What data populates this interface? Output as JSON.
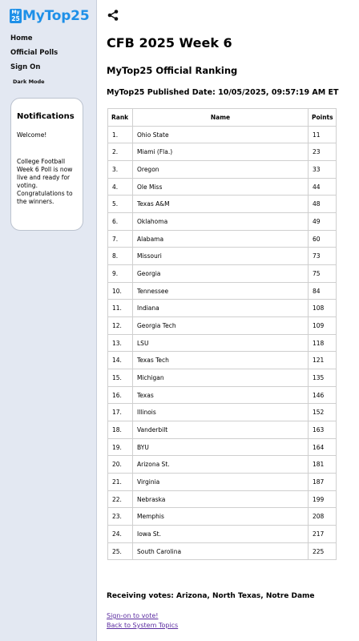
{
  "sidebar": {
    "logo_badge_top": "My",
    "logo_badge_bottom": "25",
    "logo_text": "MyTop25",
    "nav": [
      "Home",
      "Official Polls",
      "Sign On"
    ],
    "dark_mode": "Dark Mode",
    "notifications": {
      "title": "Notifications",
      "welcome": "Welcome!",
      "message": "College Football Week 6 Poll is now live and ready for voting. Congratulations to the winners."
    }
  },
  "main": {
    "share_icon": "share-icon",
    "title": "CFB 2025 Week 6",
    "subtitle": "MyTop25 Official Ranking",
    "published": "MyTop25 Published Date: 10/05/2025, 09:57:19 AM ET",
    "table": {
      "headers": [
        "Rank",
        "Name",
        "Points"
      ],
      "rows": [
        [
          "1.",
          "Ohio State",
          "11"
        ],
        [
          "2.",
          "Miami (Fla.)",
          "23"
        ],
        [
          "3.",
          "Oregon",
          "33"
        ],
        [
          "4.",
          "Ole Miss",
          "44"
        ],
        [
          "5.",
          "Texas A&M",
          "48"
        ],
        [
          "6.",
          "Oklahoma",
          "49"
        ],
        [
          "7.",
          "Alabama",
          "60"
        ],
        [
          "8.",
          "Missouri",
          "73"
        ],
        [
          "9.",
          "Georgia",
          "75"
        ],
        [
          "10.",
          "Tennessee",
          "84"
        ],
        [
          "11.",
          "Indiana",
          "108"
        ],
        [
          "12.",
          "Georgia Tech",
          "109"
        ],
        [
          "13.",
          "LSU",
          "118"
        ],
        [
          "14.",
          "Texas Tech",
          "121"
        ],
        [
          "15.",
          "Michigan",
          "135"
        ],
        [
          "16.",
          "Texas",
          "146"
        ],
        [
          "17.",
          "Illinois",
          "152"
        ],
        [
          "18.",
          "Vanderbilt",
          "163"
        ],
        [
          "19.",
          "BYU",
          "164"
        ],
        [
          "20.",
          "Arizona St.",
          "181"
        ],
        [
          "21.",
          "Virginia",
          "187"
        ],
        [
          "22.",
          "Nebraska",
          "199"
        ],
        [
          "23.",
          "Memphis",
          "208"
        ],
        [
          "24.",
          "Iowa St.",
          "217"
        ],
        [
          "25.",
          "South Carolina",
          "225"
        ]
      ]
    },
    "receiving": "Receiving votes: Arizona, North Texas, Notre Dame",
    "links": {
      "sign_on": "Sign-on to vote!",
      "back": "Back to System Topics"
    }
  },
  "colors": {
    "sidebar_bg": "#e3e8f2",
    "brand": "#1e90e8",
    "link": "#5b2ca0"
  }
}
